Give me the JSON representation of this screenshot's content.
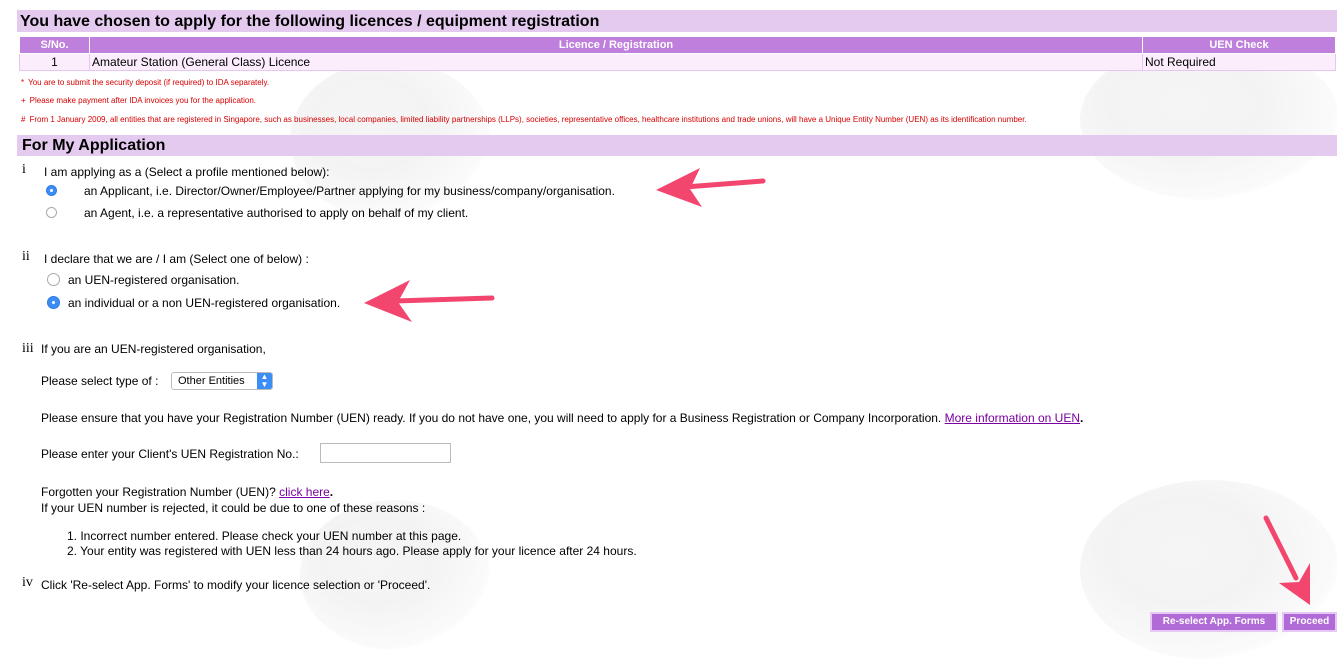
{
  "header": {
    "title": "You have chosen to apply for the following licences / equipment registration"
  },
  "table": {
    "columns": [
      "S/No.",
      "Licence / Registration",
      "UEN Check"
    ],
    "rows": [
      [
        "1",
        "Amateur Station (General Class) Licence",
        "Not Required"
      ]
    ]
  },
  "notes": [
    {
      "marker": "*",
      "text": "You are to submit the security deposit (if required) to IDA separately."
    },
    {
      "marker": "+",
      "text": "Please make payment after IDA invoices you for the application."
    },
    {
      "marker": "#",
      "text": "From 1 January 2009, all entities that are registered in Singapore, such as businesses, local companies, limited liability partnerships (LLPs), societies, representative offices, healthcare institutions and trade unions, will have a Unique Entity Number (UEN) as its identification number."
    }
  ],
  "section": {
    "title": "For My Application"
  },
  "q1": {
    "num": "i",
    "label": "I am applying as a (Select a profile mentioned below):",
    "options": [
      {
        "label": "an Applicant, i.e. Director/Owner/Employee/Partner applying for my business/company/organisation.",
        "selected": true
      },
      {
        "label": "an Agent, i.e. a representative authorised to apply on behalf of my client.",
        "selected": false
      }
    ]
  },
  "q2": {
    "num": "ii",
    "label": "I declare that we are / I am (Select one of below) :",
    "options": [
      {
        "label": "an UEN-registered organisation.",
        "selected": false
      },
      {
        "label": "an individual or a non UEN-registered organisation.",
        "selected": true
      }
    ]
  },
  "q3": {
    "num": "iii",
    "label": "If you are an UEN-registered organisation,",
    "type_label": "Please select type of :",
    "type_value": "Other Entities",
    "ensure_text": "Please ensure that you have your Registration Number (UEN) ready. If you do not have one, you will need to apply for a Business Registration or Company Incorporation.",
    "ensure_link": "More information on UEN",
    "uen_label": "Please enter your Client's UEN Registration No.:",
    "uen_value": "",
    "forgot_text": "Forgotten your Registration Number (UEN)?",
    "forgot_link": "click here",
    "rejected_text": "If your UEN number is rejected, it could be due to one of these reasons :",
    "reasons": [
      "1. Incorrect number entered. Please check your UEN number at this page.",
      "2. Your entity was registered with UEN less than 24 hours ago. Please apply for your licence after 24 hours."
    ]
  },
  "q4": {
    "num": "iv",
    "label": "Click 'Re-select App. Forms' to modify your licence selection or 'Proceed'."
  },
  "buttons": {
    "reselect": "Re-select App. Forms",
    "proceed": "Proceed"
  },
  "colors": {
    "header_bg": "#e5caf0",
    "table_header": "#bf7fdc",
    "button": "#b16bd6",
    "annotation_arrow": "#f2466f",
    "note_red": "#d60000"
  }
}
